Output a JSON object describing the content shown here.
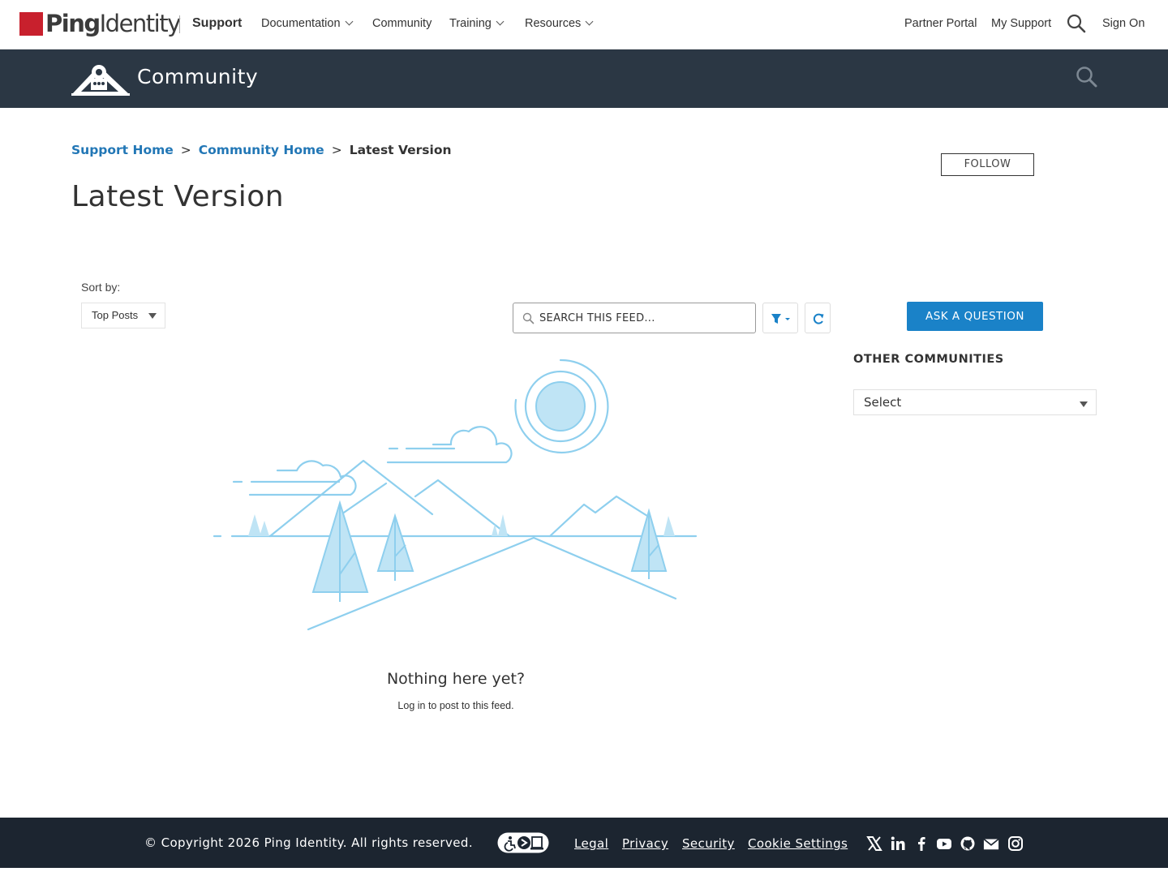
{
  "topnav": {
    "logo_bold": "Ping",
    "logo_light": "Identity",
    "support": "Support",
    "items": [
      {
        "label": "Documentation",
        "dropdown": true
      },
      {
        "label": "Community",
        "dropdown": false
      },
      {
        "label": "Training",
        "dropdown": true
      },
      {
        "label": "Resources",
        "dropdown": true
      }
    ],
    "right": [
      "Partner Portal",
      "My Support",
      "Sign On"
    ]
  },
  "banner": {
    "title": "Community"
  },
  "breadcrumb": {
    "items": [
      "Support Home",
      "Community Home",
      "Latest Version"
    ],
    "separator": ">"
  },
  "page": {
    "title": "Latest Version",
    "follow": "FOLLOW"
  },
  "feed": {
    "sort_label": "Sort by:",
    "sort_value": "Top Posts",
    "search_placeholder": "SEARCH THIS FEED...",
    "empty_title": "Nothing here yet?",
    "empty_sub": "Log in to post to this feed."
  },
  "sidebar": {
    "ask": "ASK A QUESTION",
    "other_title": "OTHER COMMUNITIES",
    "other_select": "Select"
  },
  "footer": {
    "copyright": "© Copyright 2026 Ping Identity. All rights reserved.",
    "links": [
      "Legal",
      "Privacy",
      "Security",
      "Cookie Settings"
    ],
    "social_icons": [
      "x-icon",
      "linkedin-icon",
      "facebook-icon",
      "youtube-icon",
      "github-icon",
      "email-icon",
      "instagram-icon"
    ]
  },
  "colors": {
    "brand_red": "#c8202d",
    "banner": "#2b3744",
    "link_blue": "#2277b6",
    "button_blue": "#1a82c8",
    "footer": "#1c2530",
    "illustration": "#8ecfee"
  }
}
